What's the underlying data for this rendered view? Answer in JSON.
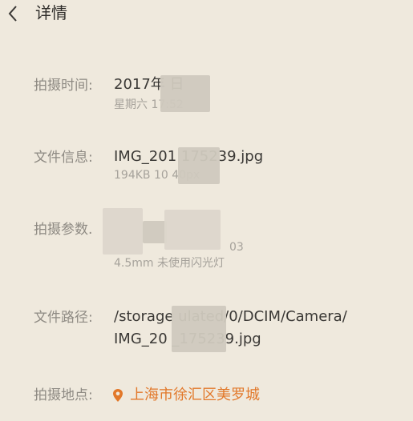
{
  "header": {
    "back_icon": "chevron-left-icon",
    "title": "详情"
  },
  "details": {
    "shot_time": {
      "label": "拍摄时间:",
      "value": "2017年 日",
      "sub": "星期六 17:52"
    },
    "file_info": {
      "label": "文件信息:",
      "value": "IMG_201 175239.jpg",
      "sub": "194KB 10 40px"
    },
    "shot_params": {
      "label": "拍摄参数.",
      "value": "",
      "sub_line1": "03",
      "sub_line2": "4.5mm 未使用闪光灯"
    },
    "file_path": {
      "label": "文件路径:",
      "line1": "/storage ulated/0/DCIM/Camera/",
      "line2": "IMG_20 _175239.jpg"
    },
    "shot_location": {
      "label": "拍摄地点:",
      "icon": "location-pin-icon",
      "value": "上海市徐汇区美罗城"
    }
  },
  "colors": {
    "background": "#efe9dd",
    "accent": "#e2782a",
    "label": "#8e8a83",
    "value": "#3a3835",
    "sub": "#a6a29b"
  }
}
